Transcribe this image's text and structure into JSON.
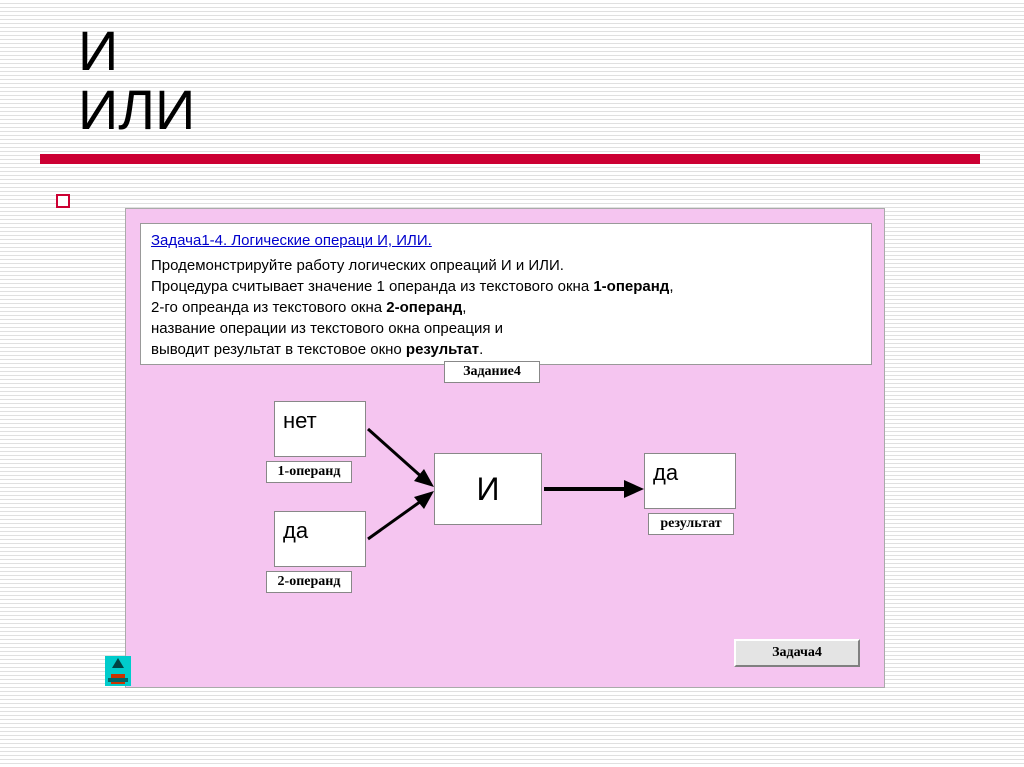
{
  "title": {
    "line1": "И",
    "line2": "ИЛИ"
  },
  "desc": {
    "link": "Задача1-4. Логические операци И, ИЛИ.",
    "l1a": "Продемонстрируйте работу логических опреаций И и ИЛИ.",
    "l2a": "Процедура считывает значение 1 операнда из текстового окна ",
    "l2b": "1-операнд",
    "l2c": ",",
    "l3a": "2-го опреанда из текстового окна ",
    "l3b": "2-операнд",
    "l3c": ",",
    "l4a": "название операции из текстового окна опреация  и",
    "l5a": " выводит результат в текстовое окно ",
    "l5b": "результат",
    "l5c": "."
  },
  "labels": {
    "task_top": "Задание4",
    "op1": "1-операнд",
    "op2": "2-операнд",
    "result": "результат",
    "task_button": "Задача4"
  },
  "inputs": {
    "operand1": "нет",
    "operand2": "да",
    "operation": "И",
    "result": "да"
  }
}
